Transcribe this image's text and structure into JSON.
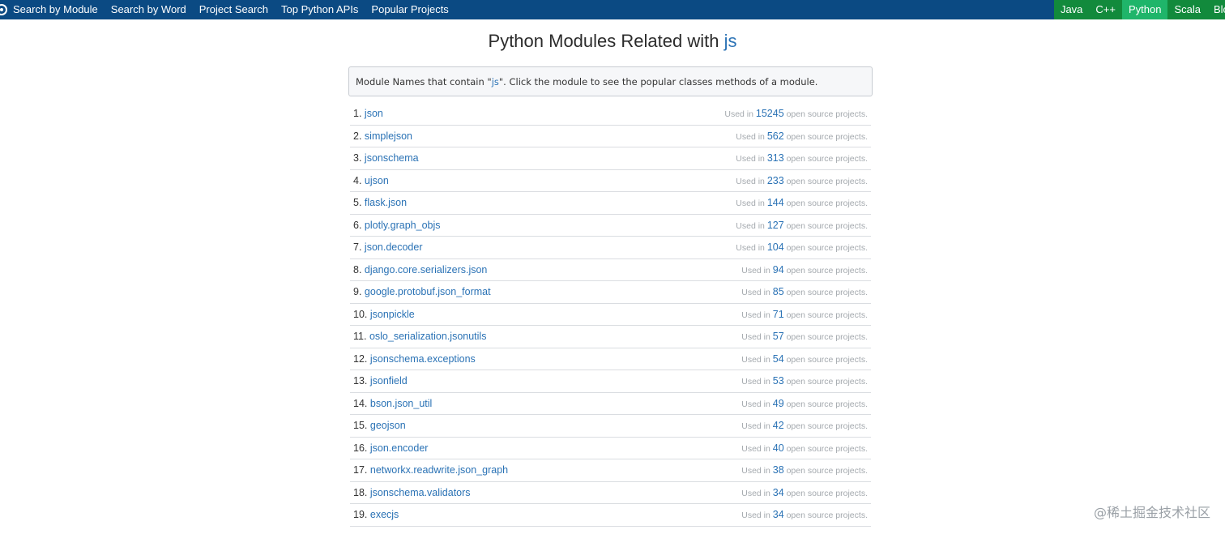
{
  "nav": {
    "links": [
      "Search by Module",
      "Search by Word",
      "Project Search",
      "Top Python APIs",
      "Popular Projects"
    ],
    "languages": [
      "Java",
      "C++",
      "Python",
      "Scala",
      "Blog"
    ],
    "active_language": "Python",
    "logo_icon": "gear-logo-icon",
    "colors": {
      "bar": "#0b4a83",
      "lang": "#128a3c",
      "lang_active": "#1fb56a"
    }
  },
  "title": {
    "prefix": "Python Modules Related with",
    "keyword": "js"
  },
  "info": {
    "before": "Module Names that contain \"",
    "keyword": "js",
    "after": "\". Click the module to see the popular classes methods of a module."
  },
  "usage": {
    "prefix": "Used in",
    "suffix": "open source projects."
  },
  "modules": [
    {
      "rank": "1.",
      "name": "json",
      "count": "15245"
    },
    {
      "rank": "2.",
      "name": "simplejson",
      "count": "562"
    },
    {
      "rank": "3.",
      "name": "jsonschema",
      "count": "313"
    },
    {
      "rank": "4.",
      "name": "ujson",
      "count": "233"
    },
    {
      "rank": "5.",
      "name": "flask.json",
      "count": "144"
    },
    {
      "rank": "6.",
      "name": "plotly.graph_objs",
      "count": "127"
    },
    {
      "rank": "7.",
      "name": "json.decoder",
      "count": "104"
    },
    {
      "rank": "8.",
      "name": "django.core.serializers.json",
      "count": "94"
    },
    {
      "rank": "9.",
      "name": "google.protobuf.json_format",
      "count": "85"
    },
    {
      "rank": "10.",
      "name": "jsonpickle",
      "count": "71"
    },
    {
      "rank": "11.",
      "name": "oslo_serialization.jsonutils",
      "count": "57"
    },
    {
      "rank": "12.",
      "name": "jsonschema.exceptions",
      "count": "54"
    },
    {
      "rank": "13.",
      "name": "jsonfield",
      "count": "53"
    },
    {
      "rank": "14.",
      "name": "bson.json_util",
      "count": "49"
    },
    {
      "rank": "15.",
      "name": "geojson",
      "count": "42"
    },
    {
      "rank": "16.",
      "name": "json.encoder",
      "count": "40"
    },
    {
      "rank": "17.",
      "name": "networkx.readwrite.json_graph",
      "count": "38"
    },
    {
      "rank": "18.",
      "name": "jsonschema.validators",
      "count": "34"
    },
    {
      "rank": "19.",
      "name": "execjs",
      "count": "34"
    }
  ],
  "watermark": "@稀土掘金技术社区"
}
